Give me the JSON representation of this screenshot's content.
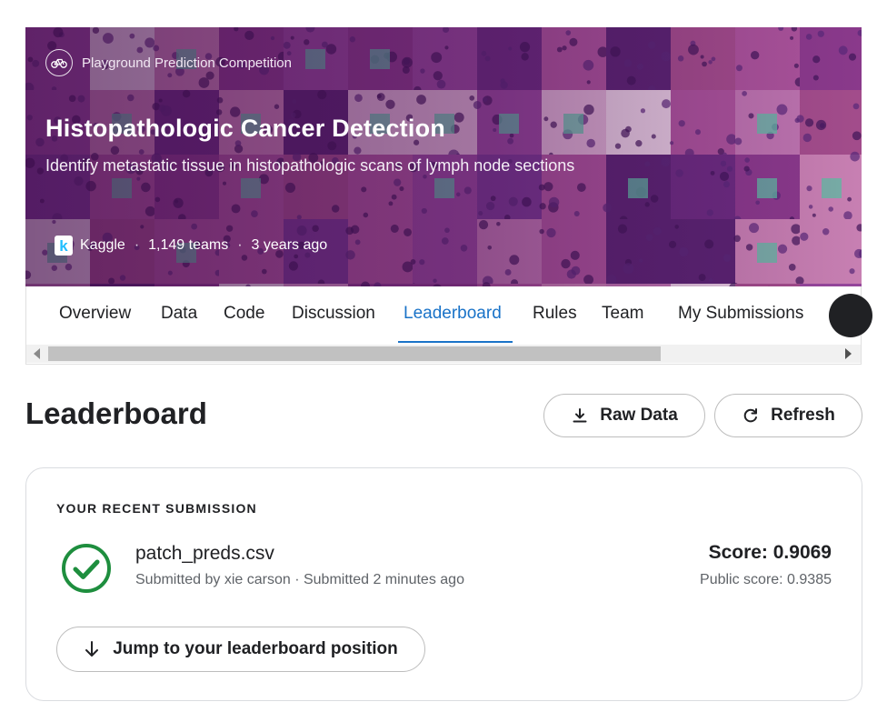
{
  "hero": {
    "competition_type": "Playground Prediction Competition",
    "title": "Histopathologic Cancer Detection",
    "subtitle": "Identify metastatic tissue in histopathologic scans of lymph node sections",
    "host": "Kaggle",
    "host_logo_letter": "k",
    "teams": "1,149 teams",
    "age": "3 years ago",
    "separator": "·"
  },
  "tabs": [
    {
      "label": "Overview"
    },
    {
      "label": "Data"
    },
    {
      "label": "Code"
    },
    {
      "label": "Discussion"
    },
    {
      "label": "Leaderboard",
      "active": true
    },
    {
      "label": "Rules"
    },
    {
      "label": "Team"
    },
    {
      "label": "My Submissions"
    }
  ],
  "leaderboard": {
    "title": "Leaderboard",
    "raw_data_label": "Raw Data",
    "refresh_label": "Refresh"
  },
  "submission": {
    "section_label": "YOUR RECENT SUBMISSION",
    "file_name": "patch_preds.csv",
    "submitted_text": "Submitted by xie carson · Submitted 2 minutes ago",
    "score": "Score: 0.9069",
    "public_score": "Public score: 0.9385",
    "status_icon": "check-circle-icon",
    "jump_label": "Jump to your leaderboard position"
  },
  "colors": {
    "accent": "#1a73c8",
    "success": "#1e8e3e",
    "hero_overlay": "#3c0a46"
  }
}
